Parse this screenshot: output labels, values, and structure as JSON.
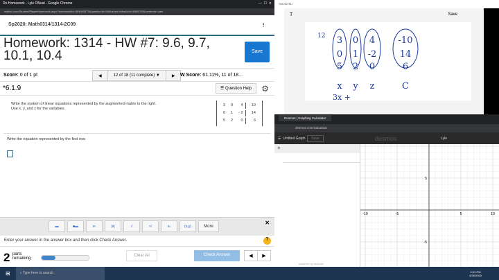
{
  "browser": {
    "title": "Do Homework - Lyle ONeal - Google Chrome",
    "url": "mathxl.com/Student/PlayerHomework.aspx?homeworkId=554945375&questionId=9&flushed=false&cId=5865790&centerwin=yes"
  },
  "course": "Sp2020: Math0314/1314-2C09",
  "homework": {
    "title": "Homework: 1314 - HW #7: 9.6, 9.7, 10.1, 10.4",
    "save_label": "Save"
  },
  "score": {
    "label": "Score:",
    "value": "0 of 1 pt",
    "hw_label": "W Score:",
    "hw_value": "61.11%, 11 of 18..."
  },
  "nav": {
    "position": "12 of 18 (11 complete)"
  },
  "question": {
    "id": "*6.1.9",
    "help_label": "Question Help",
    "instruction": "Write the system of linear equations represented by the augmented matrix to the right. Use x, y, and z for the variables.",
    "matrix": [
      [
        "3",
        "0",
        "4",
        "- 10"
      ],
      [
        "0",
        "1",
        "- 2",
        "14"
      ],
      [
        "5",
        "2",
        "0",
        "6"
      ]
    ],
    "prompt": "Write the equation represented by the first row."
  },
  "palette": {
    "buttons": [
      "fraction",
      "mixed",
      "xⁿ",
      "|x|",
      "√",
      "ⁿ√",
      "xₙ",
      "(x,y)"
    ],
    "more_label": "More"
  },
  "hint": "Enter your answer in the answer box and then click Check Answer.",
  "footer": {
    "parts": "2",
    "parts_label": "parts",
    "remaining_label": "remaining",
    "progress": 0.3,
    "clear_label": "Clear All",
    "check_label": "Check Answer"
  },
  "note": {
    "title": "SM-N975U",
    "save_label": "Save",
    "handwriting": {
      "row_label": "12",
      "vars": [
        "x",
        "y",
        "z",
        "C"
      ],
      "start": "3x +"
    }
  },
  "desmos": {
    "tab": "Desmos | Graphing Calculator",
    "url": "desmos.com/calculator",
    "graph_title": "Untitled Graph",
    "save_label": "Save",
    "brand": "desmos",
    "user": "Lyle",
    "x_ticks": [
      "-10",
      "-5",
      "5",
      "10"
    ],
    "y_ticks": [
      "5",
      "-5"
    ],
    "powered": "powered by desmos"
  },
  "taskbar": {
    "search_placeholder": "Type here to search",
    "time": "2:24 PM",
    "date": "4/30/2020"
  }
}
